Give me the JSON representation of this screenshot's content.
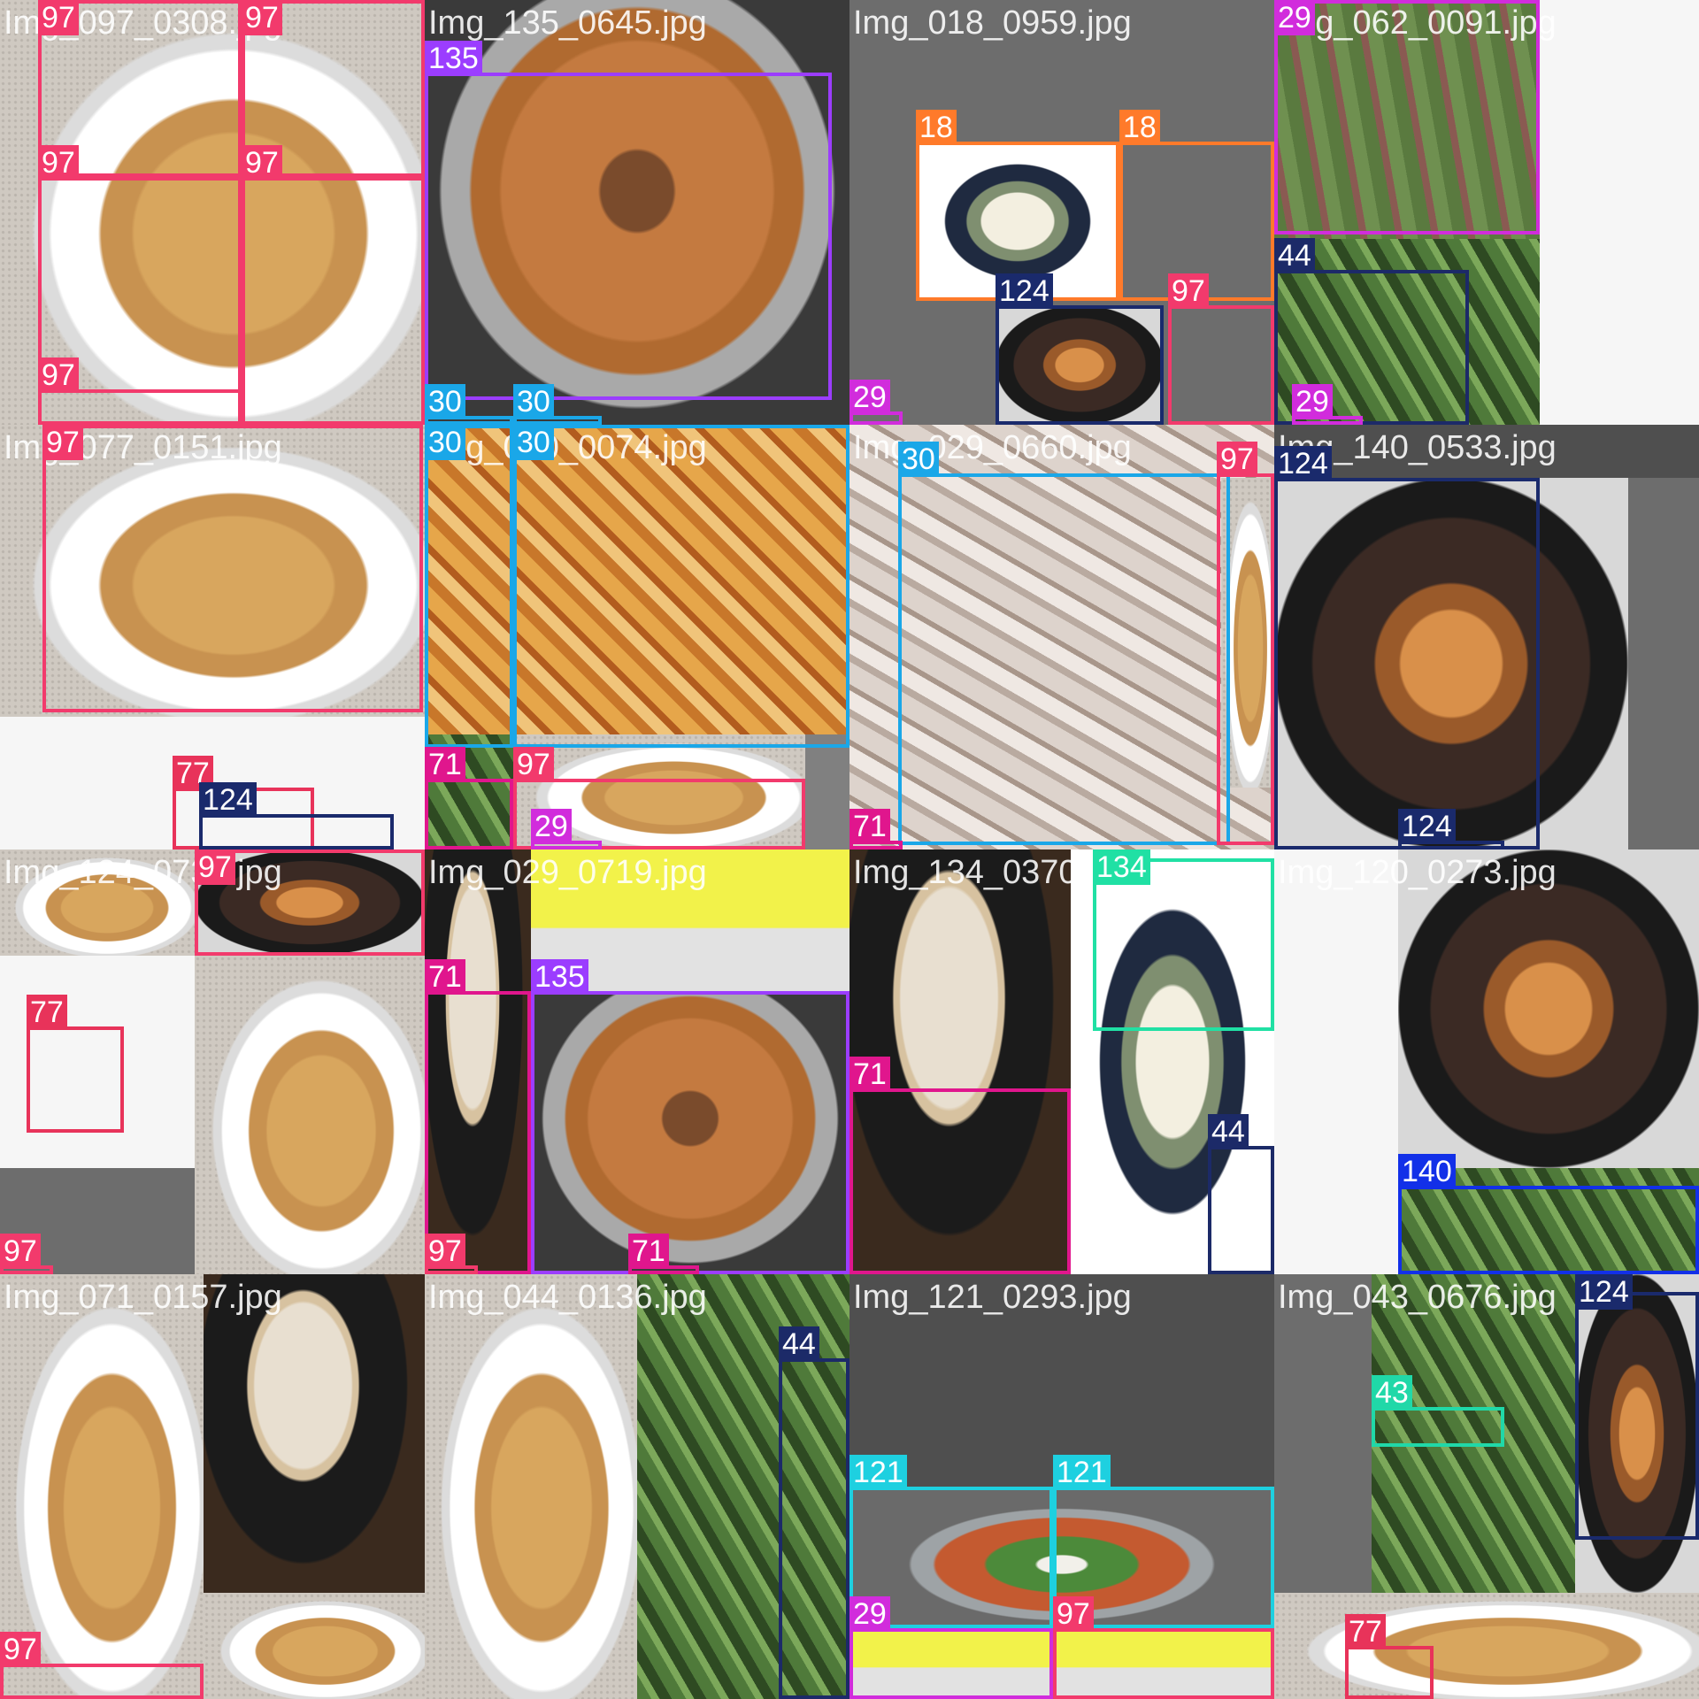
{
  "palette": {
    "c97": "#f23a6c",
    "c135": "#9b3dff",
    "c18": "#ff7a2a",
    "c29": "#d12cdc",
    "c44": "#1c2a68",
    "c124": "#1a2a6c",
    "c30": "#1aa7e8",
    "c71": "#e0168d",
    "c77": "#e8335a",
    "c134": "#20e0a4",
    "c140": "#1230e8",
    "c121": "#1ed0e0",
    "c43": "#20d8a8"
  },
  "tiles": [
    {
      "name": "Img_097_0308.jpg",
      "scene": "plate",
      "labels": [
        "97",
        "97",
        "97",
        "97",
        "97"
      ]
    },
    {
      "name": "Img_135_0645.jpg",
      "scene": "stew",
      "labels": [
        "135",
        "30",
        "30"
      ]
    },
    {
      "name": "Img_018_0959.jpg",
      "scene": "soup",
      "labels": [
        "18",
        "18",
        "124",
        "97",
        "29"
      ]
    },
    {
      "name": "Img_062_0091.jpg",
      "scene": "beans",
      "labels": [
        "29",
        "44",
        "29"
      ]
    },
    {
      "name": "Img_077_0151.jpg",
      "scene": "plate",
      "labels": [
        "97",
        "77",
        "124"
      ]
    },
    {
      "name": "Img_030_0074.jpg",
      "scene": "kimchi",
      "labels": [
        "30",
        "30",
        "71",
        "97",
        "29"
      ]
    },
    {
      "name": "Img_029_0660.jpg",
      "scene": "radish",
      "labels": [
        "30",
        "97",
        "71"
      ]
    },
    {
      "name": "Img_140_0533.jpg",
      "scene": "darkbowl",
      "labels": [
        "124",
        "124"
      ]
    },
    {
      "name": "Img_124_0736.jpg",
      "scene": "plate",
      "labels": [
        "97",
        "77",
        "97"
      ]
    },
    {
      "name": "Img_029_0719.jpg",
      "scene": "stew",
      "labels": [
        "71",
        "135",
        "97",
        "71"
      ]
    },
    {
      "name": "Img_134_0370.jpg",
      "scene": "porridge",
      "labels": [
        "134",
        "71",
        "44"
      ]
    },
    {
      "name": "Img_120_0273.jpg",
      "scene": "darkbowl",
      "labels": [
        "140"
      ]
    },
    {
      "name": "Img_071_0157.jpg",
      "scene": "porridge",
      "labels": [
        "97"
      ]
    },
    {
      "name": "Img_044_0136.jpg",
      "scene": "plate",
      "labels": [
        "44"
      ]
    },
    {
      "name": "Img_121_0293.jpg",
      "scene": "jjigae",
      "labels": [
        "121",
        "121",
        "29",
        "97"
      ]
    },
    {
      "name": "Img_043_0676.jpg",
      "scene": "greens",
      "labels": [
        "124",
        "43",
        "77"
      ]
    }
  ]
}
